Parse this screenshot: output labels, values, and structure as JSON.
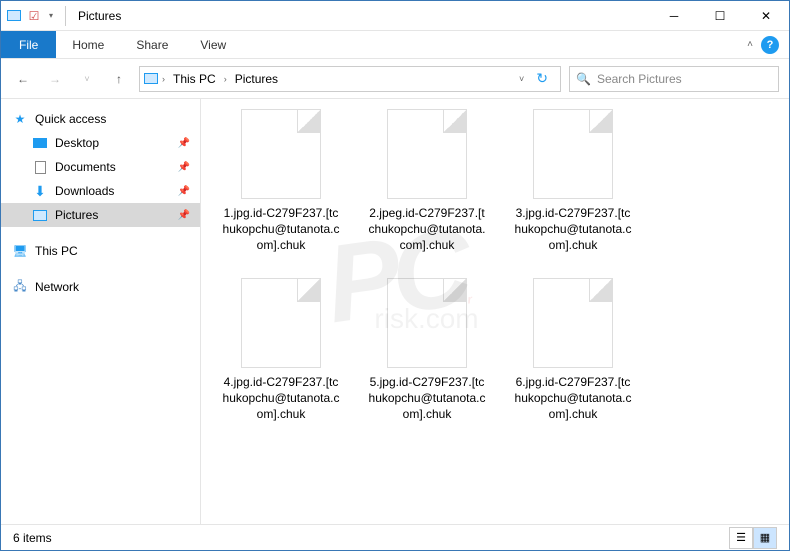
{
  "title": "Pictures",
  "ribbon": {
    "file": "File",
    "home": "Home",
    "share": "Share",
    "view": "View"
  },
  "breadcrumb": [
    "This PC",
    "Pictures"
  ],
  "search_placeholder": "Search Pictures",
  "nav": {
    "quick_access": "Quick access",
    "desktop": "Desktop",
    "documents": "Documents",
    "downloads": "Downloads",
    "pictures": "Pictures",
    "this_pc": "This PC",
    "network": "Network"
  },
  "files": [
    "1.jpg.id-C279F237.[tchukopchu@tutanota.com].chuk",
    "2.jpeg.id-C279F237.[tchukopchu@tutanota.com].chuk",
    "3.jpg.id-C279F237.[tchukopchu@tutanota.com].chuk",
    "4.jpg.id-C279F237.[tchukopchu@tutanota.com].chuk",
    "5.jpg.id-C279F237.[tchukopchu@tutanota.com].chuk",
    "6.jpg.id-C279F237.[tchukopchu@tutanota.com].chuk"
  ],
  "status": "6 items"
}
